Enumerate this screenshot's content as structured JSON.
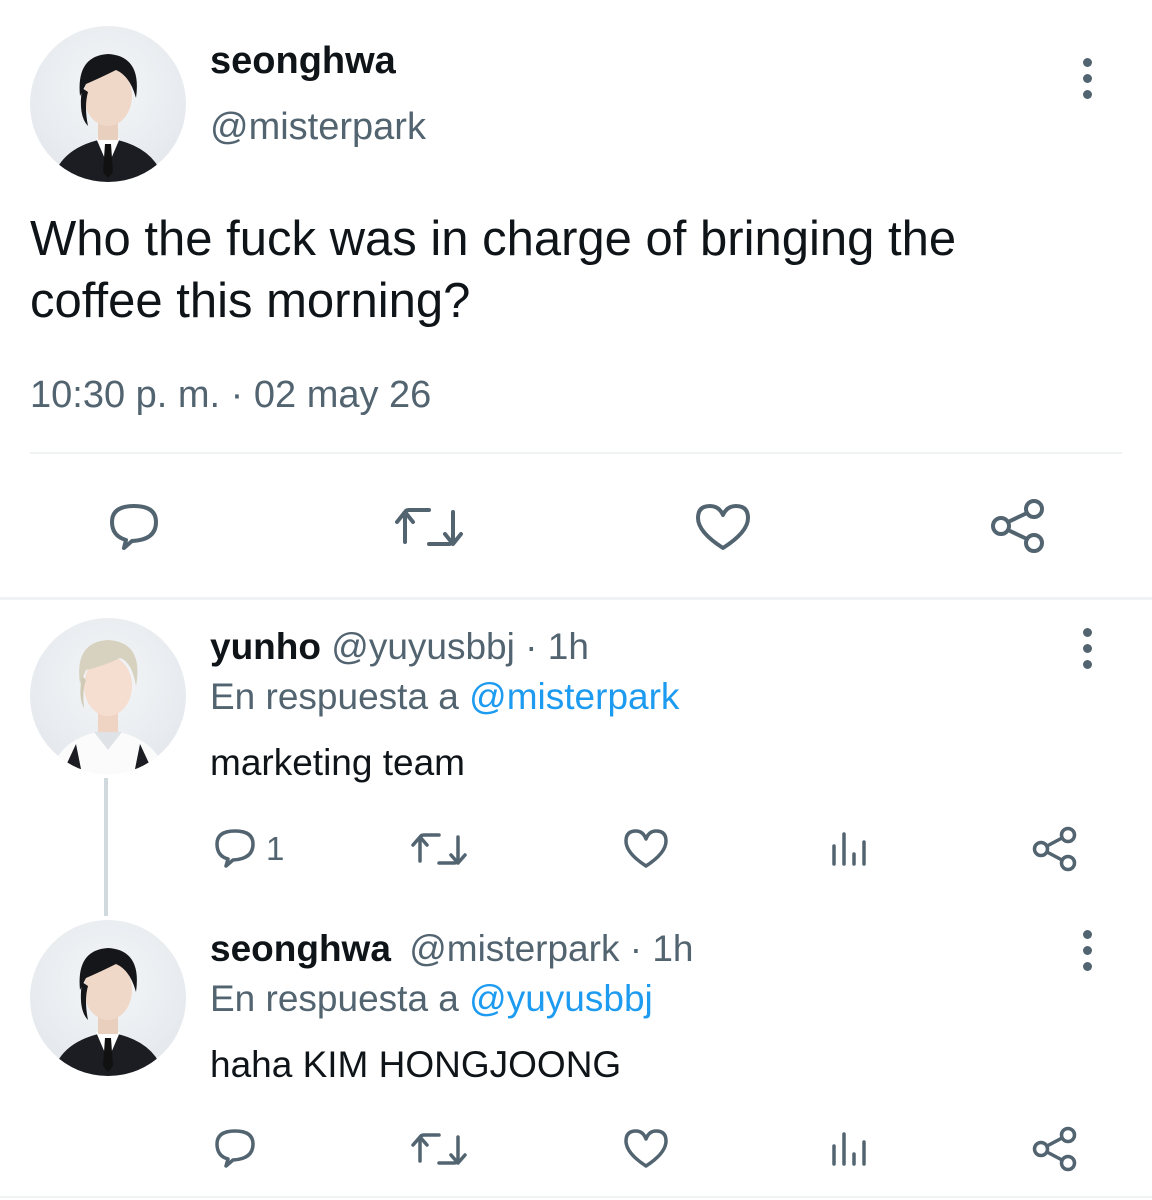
{
  "main_tweet": {
    "display_name": "seonghwa",
    "handle": "@misterpark",
    "text_line1": "Who the fuck was in charge of bringing the",
    "text_line2": "coffee this morning?",
    "timestamp": "10:30 p. m. · 02 may 26",
    "actions": [
      "reply-icon",
      "retweet-icon",
      "like-icon",
      "share-icon"
    ]
  },
  "replies": [
    {
      "display_name": "yunho",
      "handle": "@yuyusbbj",
      "time": "· 1h",
      "replying_prefix": "En respuesta a",
      "replying_to": "@misterpark",
      "text": "marketing team",
      "reply_count": "1"
    },
    {
      "display_name": "seonghwa",
      "handle": "@misterpark",
      "time": "· 1h",
      "replying_prefix": "En respuesta a",
      "replying_to": "@yuyusbbj",
      "text": "haha KIM HONGJOONG",
      "reply_count": ""
    }
  ],
  "colors": {
    "muted": "#536471",
    "link": "#1d9bf0",
    "text": "#0f1419"
  }
}
